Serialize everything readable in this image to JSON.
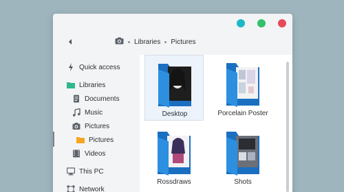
{
  "window": {
    "controls": [
      {
        "name": "minimize",
        "color": "#1fb7c7"
      },
      {
        "name": "maximize",
        "color": "#33c16b"
      },
      {
        "name": "close",
        "color": "#e64a5a"
      }
    ]
  },
  "navbar": {
    "back_icon": "chevron-left-icon",
    "location_icon": "camera-icon",
    "breadcrumbs": [
      "Libraries",
      "Pictures"
    ]
  },
  "sidebar": {
    "items": [
      {
        "label": "Quick access",
        "icon": "pin-icon"
      },
      {
        "label": "Libraries",
        "icon": "folder-green-icon"
      },
      {
        "label": "Documents",
        "icon": "document-icon"
      },
      {
        "label": "Music",
        "icon": "music-note-icon"
      },
      {
        "label": "Pictures",
        "icon": "camera-icon"
      },
      {
        "label": "Pictures",
        "icon": "folder-orange-icon"
      },
      {
        "label": "Videos",
        "icon": "film-icon"
      },
      {
        "label": "This PC",
        "icon": "monitor-icon"
      },
      {
        "label": "Network",
        "icon": "network-icon"
      }
    ]
  },
  "content": {
    "folders": [
      {
        "label": "Desktop",
        "selected": true
      },
      {
        "label": "Porcelain Poster",
        "selected": false
      },
      {
        "label": "Rossdraws",
        "selected": false
      },
      {
        "label": "Shots",
        "selected": false
      }
    ]
  },
  "colors": {
    "folder_blue": "#2c8fe0",
    "folder_blue_dark": "#1b6fc0",
    "accent_green": "#2fb88a",
    "accent_orange": "#f5a623"
  }
}
